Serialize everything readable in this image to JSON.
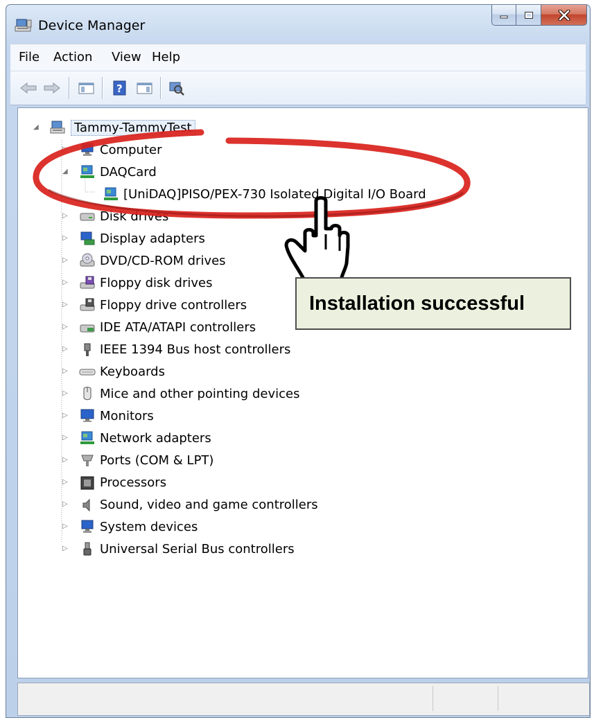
{
  "window": {
    "title": "Device Manager",
    "buttons": {
      "minimize": "minimize",
      "maximize": "maximize",
      "close": "close"
    }
  },
  "menu": {
    "items": [
      "File",
      "Action",
      "View",
      "Help"
    ]
  },
  "toolbar": {
    "icons": [
      "back-arrow-icon",
      "forward-arrow-icon",
      "show-hide-console-tree-icon",
      "help-icon",
      "properties-pane-icon",
      "scan-hardware-changes-icon"
    ]
  },
  "tree": {
    "root": "Tammy-TammyTest",
    "items": [
      {
        "label": "Computer",
        "icon": "computer-icon",
        "expanded": false
      },
      {
        "label": "DAQCard",
        "icon": "daq-card-icon",
        "expanded": true,
        "children": [
          {
            "label": "[UniDAQ]PISO/PEX-730 Isolated Digital I/O Board",
            "icon": "io-board-icon"
          }
        ]
      },
      {
        "label": "Disk drives",
        "icon": "disk-drive-icon",
        "expanded": false
      },
      {
        "label": "Display adapters",
        "icon": "display-adapter-icon",
        "expanded": false
      },
      {
        "label": "DVD/CD-ROM drives",
        "icon": "dvd-drive-icon",
        "expanded": false
      },
      {
        "label": "Floppy disk drives",
        "icon": "floppy-disk-icon",
        "expanded": false
      },
      {
        "label": "Floppy drive controllers",
        "icon": "floppy-controller-icon",
        "expanded": false
      },
      {
        "label": "IDE ATA/ATAPI controllers",
        "icon": "ide-controller-icon",
        "expanded": false
      },
      {
        "label": "IEEE 1394 Bus host controllers",
        "icon": "ieee1394-icon",
        "expanded": false
      },
      {
        "label": "Keyboards",
        "icon": "keyboard-icon",
        "expanded": false
      },
      {
        "label": "Mice and other pointing devices",
        "icon": "mouse-icon",
        "expanded": false
      },
      {
        "label": "Monitors",
        "icon": "monitor-icon",
        "expanded": false
      },
      {
        "label": "Network adapters",
        "icon": "network-adapter-icon",
        "expanded": false
      },
      {
        "label": "Ports (COM & LPT)",
        "icon": "port-icon",
        "expanded": false
      },
      {
        "label": "Processors",
        "icon": "processor-icon",
        "expanded": false
      },
      {
        "label": "Sound, video and game controllers",
        "icon": "sound-icon",
        "expanded": false
      },
      {
        "label": "System devices",
        "icon": "system-device-icon",
        "expanded": false
      },
      {
        "label": "Universal Serial Bus controllers",
        "icon": "usb-icon",
        "expanded": false
      }
    ]
  },
  "annotation": {
    "callout_text": "Installation successful",
    "ellipse_color": "#d9221c",
    "callout_bg": "#ebf1de"
  }
}
